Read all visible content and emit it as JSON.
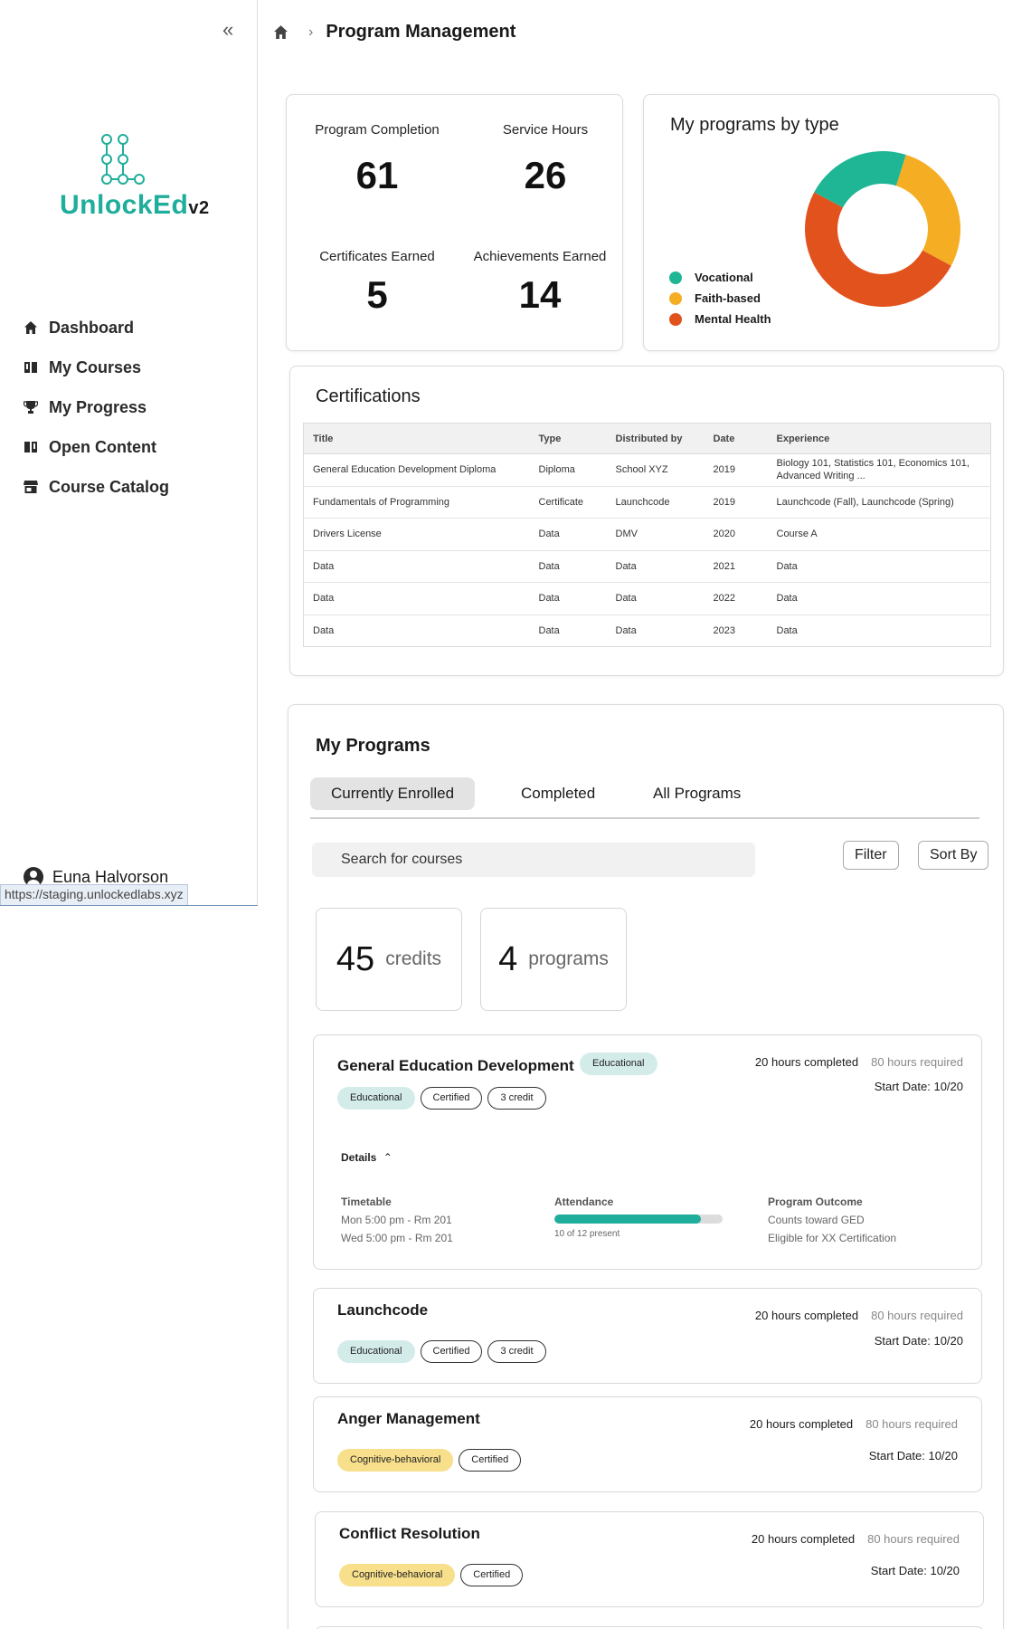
{
  "sidebar": {
    "logo_text": "UnlockEd",
    "logo_version": "v2",
    "nav": [
      {
        "label": "Dashboard",
        "icon": "home-icon"
      },
      {
        "label": "My Courses",
        "icon": "book-icon"
      },
      {
        "label": "My Progress",
        "icon": "trophy-icon"
      },
      {
        "label": "Open Content",
        "icon": "book-open-icon"
      },
      {
        "label": "Course Catalog",
        "icon": "storefront-icon"
      }
    ],
    "user_name": "Euna Halvorson",
    "status_url": "https://staging.unlockedlabs.xyz"
  },
  "header": {
    "title": "Program Management"
  },
  "stats": {
    "program_completion": {
      "label": "Program Completion",
      "value": "61"
    },
    "service_hours": {
      "label": "Service Hours",
      "value": "26"
    },
    "certificates": {
      "label": "Certificates Earned",
      "value": "5"
    },
    "achievements": {
      "label": "Achievements Earned",
      "value": "14"
    }
  },
  "donut": {
    "title": "My programs by type",
    "legend": [
      {
        "label": "Vocational",
        "color": "#1fb696"
      },
      {
        "label": "Faith-based",
        "color": "#f5ad24"
      },
      {
        "label": "Mental Health",
        "color": "#e2521c"
      }
    ]
  },
  "chart_data": {
    "type": "pie",
    "title": "My programs by type",
    "categories": [
      "Vocational",
      "Faith-based",
      "Mental Health"
    ],
    "values": [
      22,
      28,
      50
    ],
    "colors": [
      "#1fb696",
      "#f5ad24",
      "#e2521c"
    ],
    "donut": true,
    "legend_position": "left"
  },
  "certifications": {
    "title": "Certifications",
    "columns": [
      "Title",
      "Type",
      "Distributed by",
      "Date",
      "Experience"
    ],
    "rows": [
      [
        "General Education Development Diploma",
        "Diploma",
        "School XYZ",
        "2019",
        "Biology 101, Statistics 101, Economics 101, Advanced Writing ..."
      ],
      [
        "Fundamentals of Programming",
        "Certificate",
        "Launchcode",
        "2019",
        "Launchcode (Fall), Launchcode (Spring)"
      ],
      [
        "Drivers License",
        "Data",
        "DMV",
        "2020",
        "Course A"
      ],
      [
        "Data",
        "Data",
        "Data",
        "2021",
        "Data"
      ],
      [
        "Data",
        "Data",
        "Data",
        "2022",
        "Data"
      ],
      [
        "Data",
        "Data",
        "Data",
        "2023",
        "Data"
      ]
    ]
  },
  "programs": {
    "title": "My Programs",
    "tabs": [
      "Currently Enrolled",
      "Completed",
      "All Programs"
    ],
    "search_placeholder": "Search for courses",
    "filter_label": "Filter",
    "sort_label": "Sort By",
    "credits": {
      "value": "45",
      "unit": "credits"
    },
    "count": {
      "value": "4",
      "unit": "programs"
    },
    "items": [
      {
        "name": "General Education Development",
        "inline_badge": "Educational",
        "tags": [
          "Educational",
          "Certified",
          "3 credit"
        ],
        "hours_completed": "20 hours completed",
        "hours_required": "80 hours required",
        "start": "Start Date: 10/20",
        "details_label": "Details",
        "timetable_label": "Timetable",
        "timetable": [
          "Mon 5:00 pm - Rm 201",
          "Wed 5:00 pm - Rm 201"
        ],
        "attendance_label": "Attendance",
        "attendance_fraction": 0.87,
        "attendance_text": "10 of 12 present",
        "outcome_label": "Program Outcome",
        "outcome": [
          "Counts toward GED",
          "Eligible for XX Certification"
        ]
      },
      {
        "name": "Launchcode",
        "tags": [
          "Educational",
          "Certified",
          "3 credit"
        ],
        "hours_completed": "20 hours completed",
        "hours_required": "80 hours required",
        "start": "Start Date: 10/20"
      },
      {
        "name": "Anger Management",
        "tags": [
          "Cognitive-behavioral",
          "Certified"
        ],
        "hours_completed": "20 hours completed",
        "hours_required": "80 hours required",
        "start": "Start Date: 10/20"
      },
      {
        "name": "Conflict Resolution",
        "tags": [
          "Cognitive-behavioral",
          "Certified"
        ],
        "hours_completed": "20 hours completed",
        "hours_required": "80 hours required",
        "start": "Start Date: 10/20"
      }
    ]
  }
}
